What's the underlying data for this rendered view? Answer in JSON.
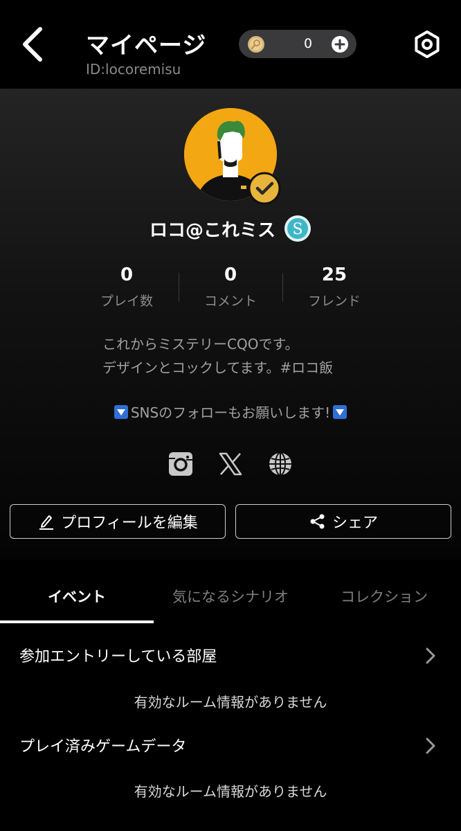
{
  "header": {
    "title": "マイページ",
    "user_id": "ID:locoremisu",
    "coin_count": "0"
  },
  "profile": {
    "name": "ロコ@これミス",
    "stats": [
      {
        "value": "0",
        "label": "プレイ数"
      },
      {
        "value": "0",
        "label": "コメント"
      },
      {
        "value": "25",
        "label": "フレンド"
      }
    ],
    "bio_line1": "これからミステリーCQOです。",
    "bio_line2": "デザインとコックしてます。#ロコ飯",
    "sns_note": "SNSのフォローもお願いします!",
    "edit_button": "プロフィールを編集",
    "share_button": "シェア"
  },
  "tabs": [
    {
      "label": "イベント",
      "active": true
    },
    {
      "label": "気になるシナリオ",
      "active": false
    },
    {
      "label": "コレクション",
      "active": false
    }
  ],
  "sections": [
    {
      "title": "参加エントリーしている部屋",
      "empty_message": "有効なルーム情報がありません"
    },
    {
      "title": "プレイ済みゲームデータ",
      "empty_message": "有効なルーム情報がありません"
    }
  ],
  "colors": {
    "avatar_bg": "#f3a712",
    "badge_gold": "#e8b43a",
    "s_badge": "#3fb6c8",
    "sns_arrow": "#2f6fd6"
  },
  "icons": [
    "back-icon",
    "coin-icon",
    "plus-icon",
    "settings-icon",
    "checkmark-icon",
    "s-icon",
    "instagram-icon",
    "x-icon",
    "globe-icon",
    "pencil-icon",
    "share-icon",
    "chevron-right-icon"
  ]
}
